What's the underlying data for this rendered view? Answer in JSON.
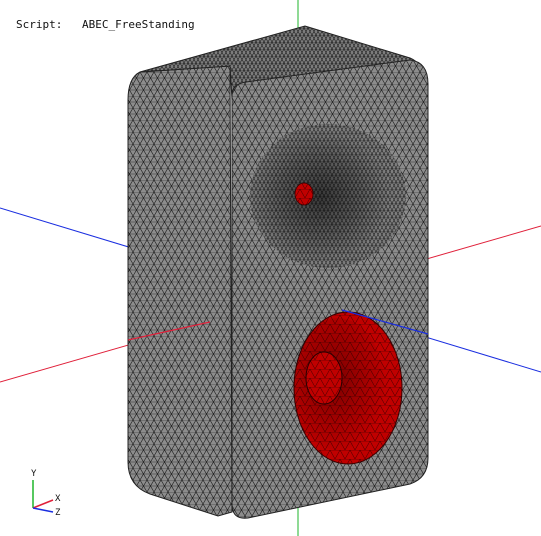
{
  "header": {
    "script_label": "Script:",
    "script_name": "ABEC_FreeStanding"
  },
  "triad": {
    "x_label": "X",
    "y_label": "Y",
    "z_label": "Z"
  },
  "colors": {
    "mesh_fill": "#8c8c8c",
    "mesh_line": "#1a1a1a",
    "driver_red": "#c00000",
    "axis_x": "#e0203a",
    "axis_y": "#1fb52b",
    "axis_z": "#1a2ee0"
  }
}
